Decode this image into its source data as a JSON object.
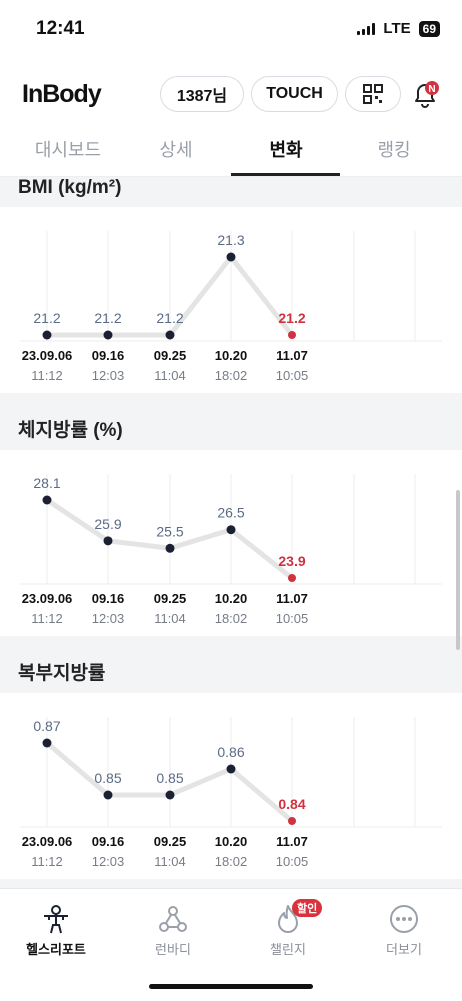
{
  "status": {
    "time": "12:41",
    "network": "LTE",
    "battery": "69"
  },
  "header": {
    "logo": "InBody",
    "user_chip": "1387님",
    "touch_label": "TOUCH",
    "notification_badge": "N"
  },
  "tabs": [
    {
      "label": "대시보드",
      "active": false
    },
    {
      "label": "상세",
      "active": false
    },
    {
      "label": "변화",
      "active": true
    },
    {
      "label": "랭킹",
      "active": false
    }
  ],
  "colors": {
    "accent": "#d0323f",
    "point": "#1c2033",
    "line": "#e4e4e4",
    "value_text": "#5b6b85"
  },
  "chart_data": [
    {
      "type": "line",
      "title": "BMI (kg/m²)",
      "dates": [
        "23.09.06",
        "09.16",
        "09.25",
        "10.20",
        "11.07"
      ],
      "times": [
        "11:12",
        "12:03",
        "11:04",
        "18:02",
        "10:05"
      ],
      "values": [
        21.2,
        21.2,
        21.2,
        21.3,
        21.2
      ],
      "labels": [
        "21.2",
        "21.2",
        "21.2",
        "21.3",
        "21.2"
      ]
    },
    {
      "type": "line",
      "title": "체지방률 (%)",
      "dates": [
        "23.09.06",
        "09.16",
        "09.25",
        "10.20",
        "11.07"
      ],
      "times": [
        "11:12",
        "12:03",
        "11:04",
        "18:02",
        "10:05"
      ],
      "values": [
        28.1,
        25.9,
        25.5,
        26.5,
        23.9
      ],
      "labels": [
        "28.1",
        "25.9",
        "25.5",
        "26.5",
        "23.9"
      ]
    },
    {
      "type": "line",
      "title": "복부지방률",
      "dates": [
        "23.09.06",
        "09.16",
        "09.25",
        "10.20",
        "11.07"
      ],
      "times": [
        "11:12",
        "12:03",
        "11:04",
        "18:02",
        "10:05"
      ],
      "values": [
        0.87,
        0.85,
        0.85,
        0.86,
        0.84
      ],
      "labels": [
        "0.87",
        "0.85",
        "0.85",
        "0.86",
        "0.84"
      ]
    }
  ],
  "bottom_nav": [
    {
      "label": "헬스리포트",
      "icon": "person-report-icon",
      "active": true
    },
    {
      "label": "런바디",
      "icon": "network-icon",
      "active": false
    },
    {
      "label": "챌린지",
      "icon": "flame-icon",
      "active": false,
      "badge": "할인"
    },
    {
      "label": "더보기",
      "icon": "more-icon",
      "active": false
    }
  ]
}
